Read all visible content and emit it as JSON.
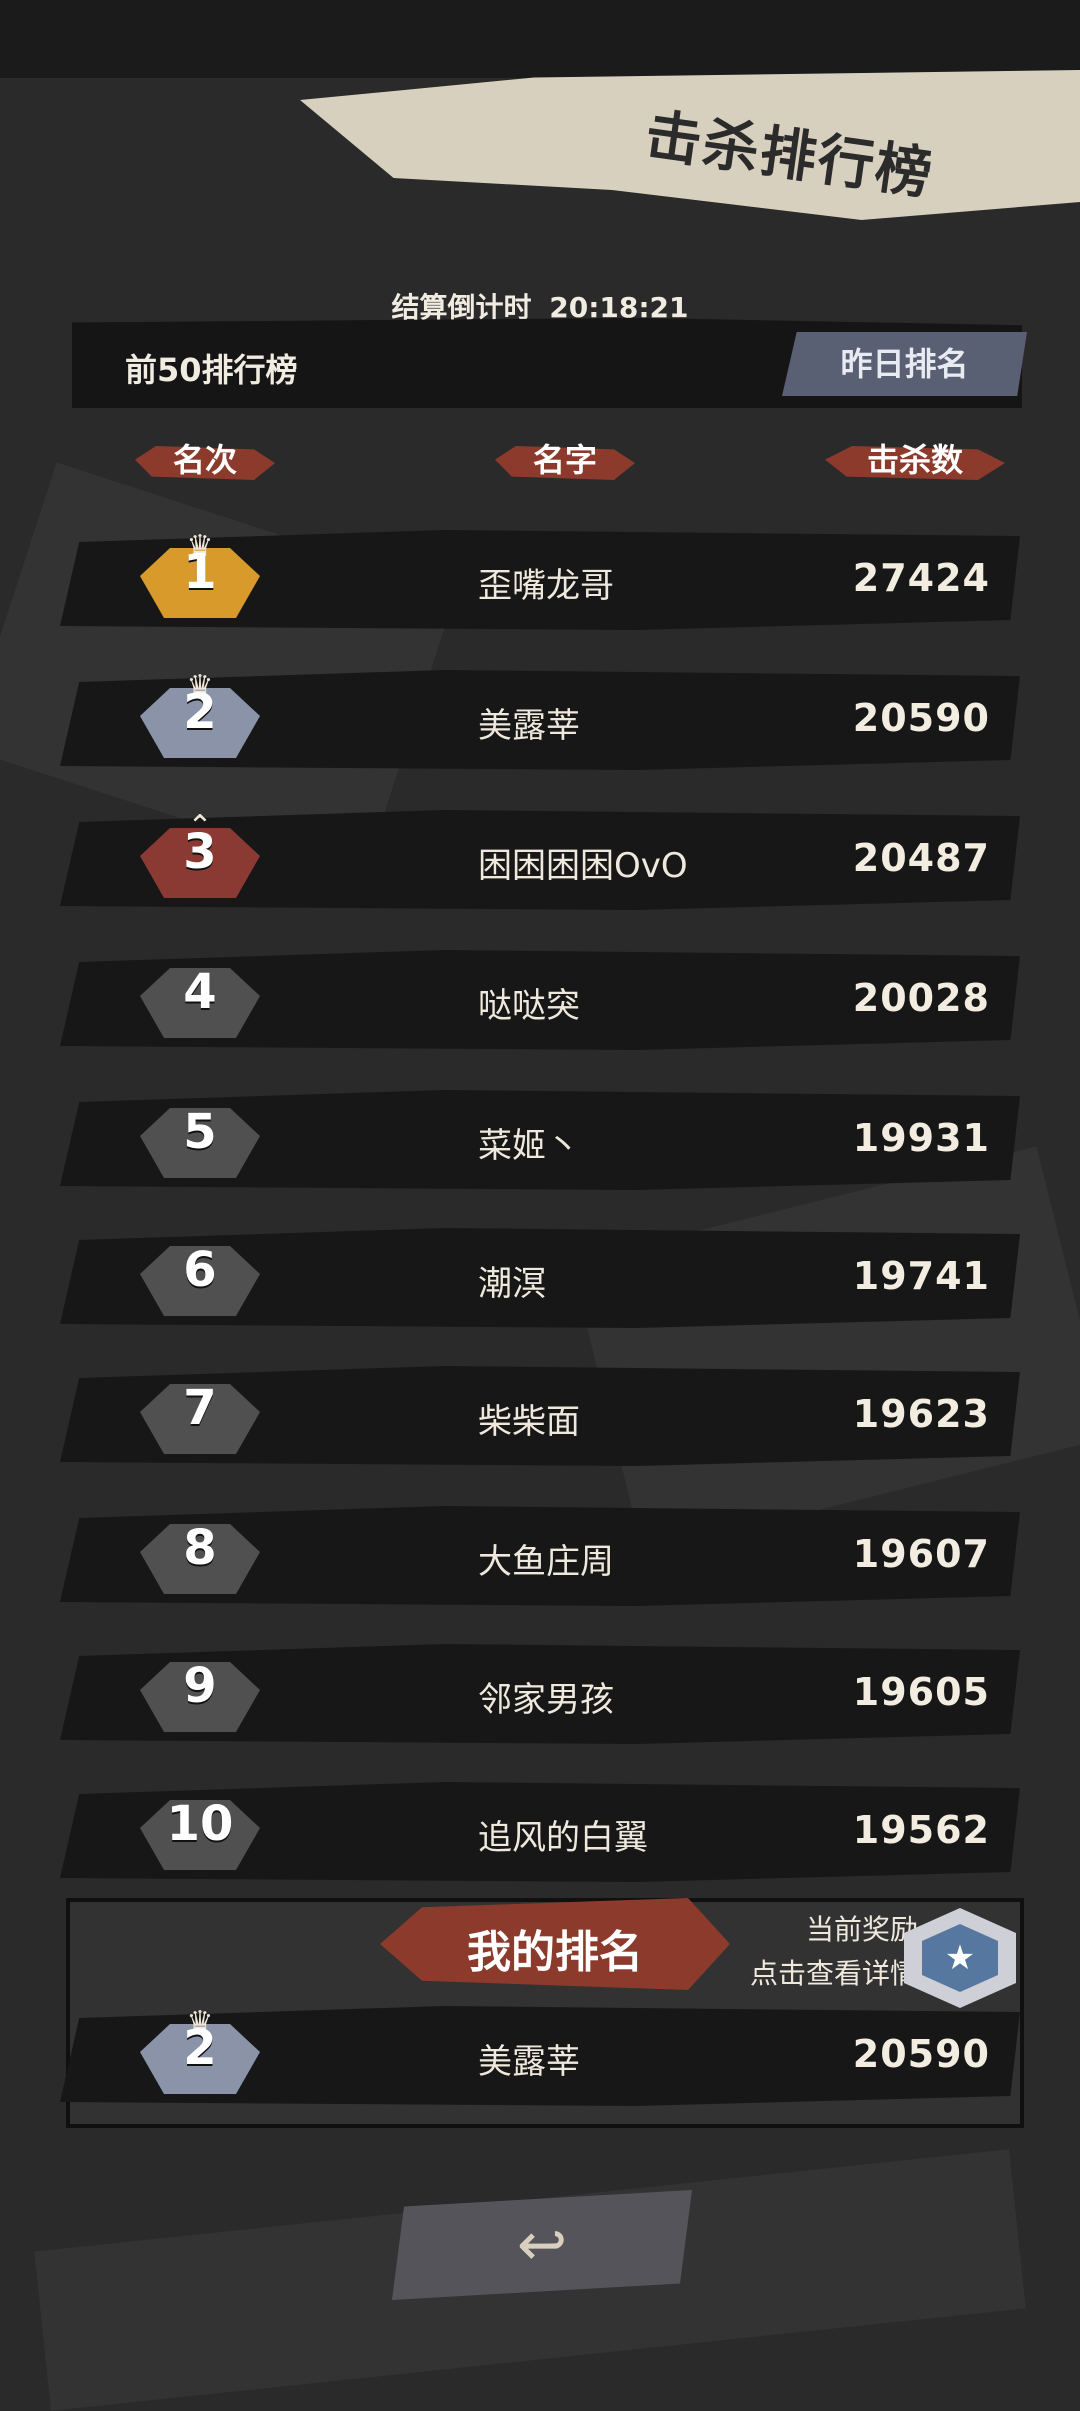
{
  "title": "击杀排行榜",
  "countdown": {
    "label": "结算倒计时",
    "time": "20:18:21"
  },
  "tabs": {
    "top50_label": "前50排行榜",
    "yesterday_label": "昨日排名"
  },
  "columns": {
    "rank": "名次",
    "name": "名字",
    "kills": "击杀数"
  },
  "rows": [
    {
      "rank": "1",
      "name": "歪嘴龙哥",
      "kills": "27424",
      "medal": "gold"
    },
    {
      "rank": "2",
      "name": "美露莘",
      "kills": "20590",
      "medal": "silver"
    },
    {
      "rank": "3",
      "name": "困困困困OvO",
      "kills": "20487",
      "medal": "bronze"
    },
    {
      "rank": "4",
      "name": "哒哒突",
      "kills": "20028",
      "medal": "gray"
    },
    {
      "rank": "5",
      "name": "菜姬丶",
      "kills": "19931",
      "medal": "gray"
    },
    {
      "rank": "6",
      "name": "潮溟",
      "kills": "19741",
      "medal": "gray"
    },
    {
      "rank": "7",
      "name": "柴柴面",
      "kills": "19623",
      "medal": "gray"
    },
    {
      "rank": "8",
      "name": "大鱼庄周",
      "kills": "19607",
      "medal": "gray"
    },
    {
      "rank": "9",
      "name": "邻家男孩",
      "kills": "19605",
      "medal": "gray"
    },
    {
      "rank": "10",
      "name": "追风的白翼",
      "kills": "19562",
      "medal": "gray"
    }
  ],
  "my_rank": {
    "title": "我的排名",
    "reward_line1": "当前奖励",
    "reward_line2": "点击查看详情",
    "rank": "2",
    "name": "美露莘",
    "kills": "20590"
  },
  "icons": {
    "crown": "crown-icon",
    "back": "back-arrow-icon",
    "reward": "reward-badge-icon"
  },
  "colors": {
    "background": "#2a2a2a",
    "accent_red": "#8b3a2c",
    "gold": "#d99a2c",
    "silver": "#8a93a8",
    "bronze": "#8a3a33",
    "banner": "#d8d0bf",
    "tab_button": "#5a6073"
  }
}
